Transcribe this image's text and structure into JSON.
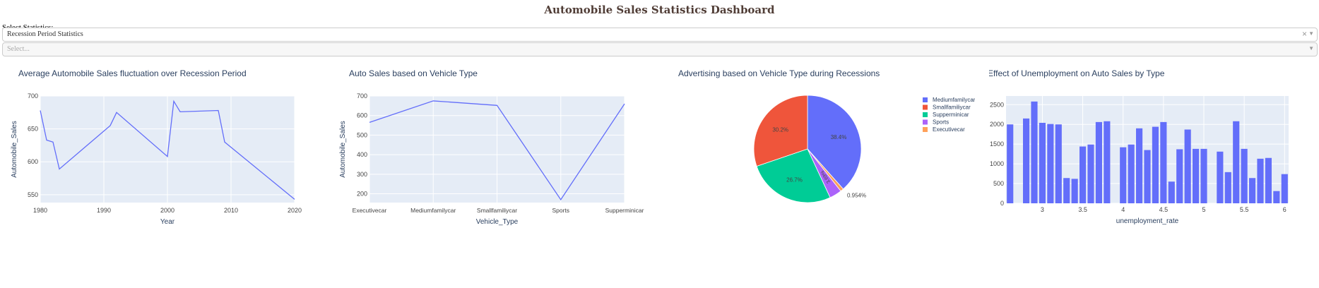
{
  "header": {
    "title": "Automobile Sales Statistics Dashboard"
  },
  "controls": {
    "select_label": "Select Statistics:",
    "dropdown1": {
      "value": "Recession Period Statistics",
      "clear_icon": "close-icon",
      "arrow_icon": "chevron-down-icon"
    },
    "dropdown2": {
      "placeholder": "Select...",
      "arrow_icon": "chevron-down-icon"
    }
  },
  "colors": {
    "plot_bg": "#e5ecf6",
    "line": "#636efa",
    "title_text": "#2a3f5f",
    "Mediumfamilycar": "#636efa",
    "Smallfamiliycar": "#ef553b",
    "Supperminicar": "#00cc96",
    "Sports": "#ab63fa",
    "Executivecar": "#ffa15a"
  },
  "chart_data": [
    {
      "type": "line",
      "title": "Average Automobile Sales fluctuation over Recession Period",
      "xlabel": "Year",
      "ylabel": "Automobile_Sales",
      "x": [
        1980,
        1981,
        1982,
        1983,
        1991,
        1992,
        2000,
        2001,
        2002,
        2008,
        2009,
        2020
      ],
      "y": [
        678,
        633,
        630,
        589,
        655,
        675,
        608,
        692,
        676,
        678,
        630,
        543
      ],
      "xlim": [
        1980,
        2020
      ],
      "ylim": [
        538,
        700
      ],
      "xticks": [
        "1980",
        "1990",
        "2000",
        "2010",
        "2020"
      ],
      "xtick_values": [
        1980,
        1990,
        2000,
        2010,
        2020
      ],
      "yticks": [
        "550",
        "600",
        "650",
        "700"
      ],
      "ytick_values": [
        550,
        600,
        650,
        700
      ],
      "grid": true
    },
    {
      "type": "line",
      "title": "Auto Sales based on Vehicle Type",
      "xlabel": "Vehicle_Type",
      "ylabel": "Automobile_Sales",
      "categories": [
        "Executivecar",
        "Mediumfamilycar",
        "Smallfamiliycar",
        "Sports",
        "Supperminicar"
      ],
      "values": [
        565,
        675,
        652,
        170,
        660
      ],
      "ylim": [
        155,
        700
      ],
      "yticks": [
        "200",
        "300",
        "400",
        "500",
        "600",
        "700"
      ],
      "ytick_values": [
        200,
        300,
        400,
        500,
        600,
        700
      ],
      "grid": true
    },
    {
      "type": "pie",
      "title": "Advertising based on Vehicle Type during Recessions",
      "slices": [
        {
          "label": "Mediumfamilycar",
          "value": 38.4,
          "text": "38.4%"
        },
        {
          "label": "Executivecar",
          "value": 0.954,
          "text": "0.954%"
        },
        {
          "label": "Sports",
          "value": 3.69,
          "text": "3.69%"
        },
        {
          "label": "Supperminicar",
          "value": 26.7,
          "text": "26.7%"
        },
        {
          "label": "Smallfamiliycar",
          "value": 30.2,
          "text": "30.2%"
        }
      ],
      "legend": [
        "Mediumfamilycar",
        "Smallfamiliycar",
        "Supperminicar",
        "Sports",
        "Executivecar"
      ],
      "legend_position": "right"
    },
    {
      "type": "bar",
      "title": "Effect of Unemployment on Auto Sales by Type",
      "xlabel": "unemployment_rate",
      "ylabel": "Automobile_Sales",
      "x": [
        2.6,
        2.8,
        2.9,
        3.0,
        3.1,
        3.2,
        3.3,
        3.4,
        3.5,
        3.6,
        3.7,
        3.8,
        4.0,
        4.1,
        4.2,
        4.3,
        4.4,
        4.5,
        4.6,
        4.7,
        4.8,
        4.9,
        5.0,
        5.2,
        5.3,
        5.4,
        5.5,
        5.6,
        5.7,
        5.8,
        5.9,
        6.0
      ],
      "values": [
        2000,
        2150,
        2580,
        2040,
        2010,
        2000,
        640,
        620,
        1440,
        1490,
        2060,
        2080,
        1420,
        1490,
        1900,
        1350,
        1940,
        2060,
        550,
        1370,
        1870,
        1380,
        1380,
        1310,
        790,
        2080,
        1380,
        640,
        1130,
        1150,
        310,
        740
      ],
      "xlim": [
        2.55,
        6.05
      ],
      "ylim": [
        0,
        2720
      ],
      "xticks": [
        "3",
        "3.5",
        "4",
        "4.5",
        "5",
        "5.5",
        "6"
      ],
      "xtick_values": [
        3,
        3.5,
        4,
        4.5,
        5,
        5.5,
        6
      ],
      "yticks": [
        "0",
        "500",
        "1000",
        "1500",
        "2000",
        "2500"
      ],
      "ytick_values": [
        0,
        500,
        1000,
        1500,
        2000,
        2500
      ],
      "grid": true
    }
  ]
}
